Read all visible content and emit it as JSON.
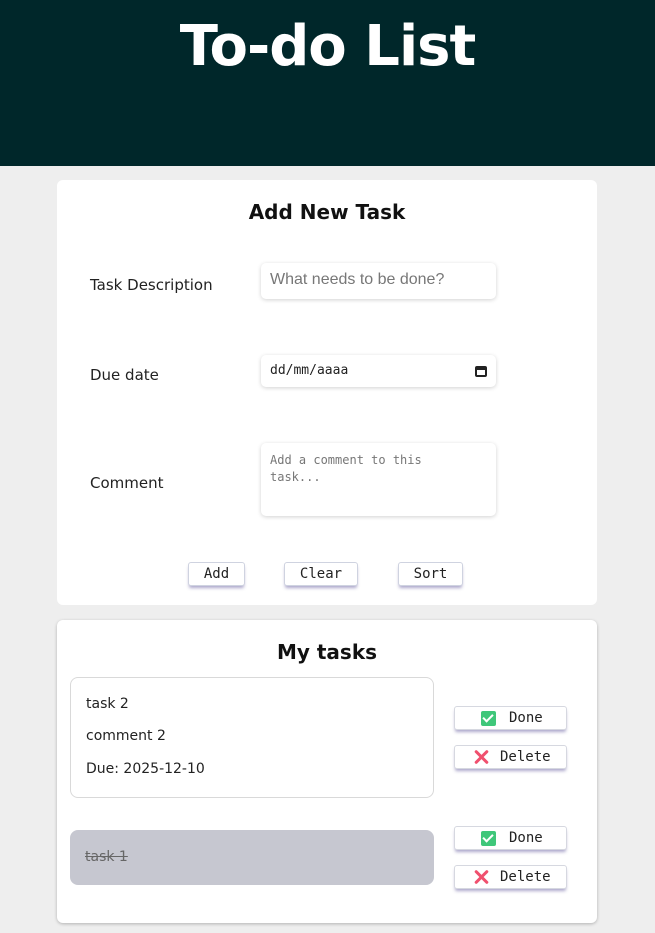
{
  "header": {
    "title": "To-do List"
  },
  "add_task": {
    "title": "Add New Task",
    "description": {
      "label": "Task Description",
      "placeholder": "What needs to be done?"
    },
    "due_date": {
      "label": "Due date",
      "placeholder": "dd/mm/aaaa"
    },
    "comment": {
      "label": "Comment",
      "placeholder_line1": "Add a comment to this",
      "placeholder_line2": "task..."
    },
    "buttons": {
      "add": "Add",
      "clear": "Clear",
      "sort": "Sort"
    }
  },
  "tasks": {
    "title": "My tasks",
    "items": [
      {
        "name": "task 2",
        "comment": "comment 2",
        "due": "Due: 2025-12-10",
        "done": false
      },
      {
        "name": "task 1",
        "done": true
      }
    ],
    "done_label": "Done",
    "delete_label": "Delete"
  },
  "colors": {
    "header_bg": "#00272a",
    "page_bg": "#eeeeee",
    "done_task_bg": "#c6c7d0",
    "check": "#3fc77a",
    "delete": "#f0506e"
  },
  "icons": [
    "check-icon",
    "close-icon",
    "calendar-icon"
  ]
}
